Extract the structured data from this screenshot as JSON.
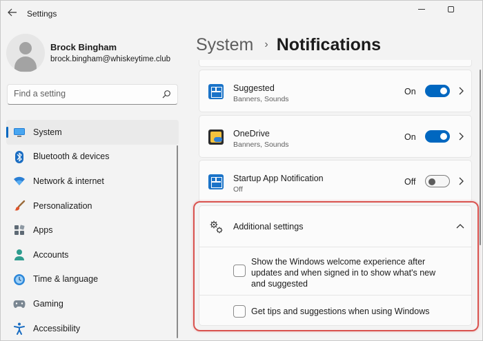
{
  "window": {
    "title": "Settings"
  },
  "profile": {
    "name": "Brock Bingham",
    "email": "brock.bingham@whiskeytime.club"
  },
  "search": {
    "placeholder": "Find a setting"
  },
  "sidebar": {
    "items": [
      {
        "label": "System",
        "icon": "system-icon",
        "active": true
      },
      {
        "label": "Bluetooth & devices",
        "icon": "bluetooth-icon"
      },
      {
        "label": "Network & internet",
        "icon": "network-icon"
      },
      {
        "label": "Personalization",
        "icon": "brush-icon"
      },
      {
        "label": "Apps",
        "icon": "apps-icon"
      },
      {
        "label": "Accounts",
        "icon": "accounts-icon"
      },
      {
        "label": "Time & language",
        "icon": "time-icon"
      },
      {
        "label": "Gaming",
        "icon": "gaming-icon"
      },
      {
        "label": "Accessibility",
        "icon": "accessibility-icon"
      }
    ]
  },
  "breadcrumb": {
    "parent": "System",
    "separator": "›",
    "current": "Notifications"
  },
  "notifications": [
    {
      "title": "Suggested",
      "subtitle": "Banners, Sounds",
      "state": "On",
      "enabled": true,
      "icon": "suggested-app-icon"
    },
    {
      "title": "OneDrive",
      "subtitle": "Banners, Sounds",
      "state": "On",
      "enabled": true,
      "icon": "onedrive-icon"
    },
    {
      "title": "Startup App Notification",
      "subtitle": "Off",
      "state": "Off",
      "enabled": false,
      "icon": "startup-app-icon"
    }
  ],
  "additional_settings": {
    "title": "Additional settings",
    "expanded": true,
    "options": [
      {
        "label": "Show the Windows welcome experience after updates and when signed in to show what's new and suggested",
        "checked": false
      },
      {
        "label": "Get tips and suggestions when using Windows",
        "checked": false
      }
    ]
  },
  "colors": {
    "accent": "#0067c0",
    "highlight_border": "#d9534f"
  }
}
